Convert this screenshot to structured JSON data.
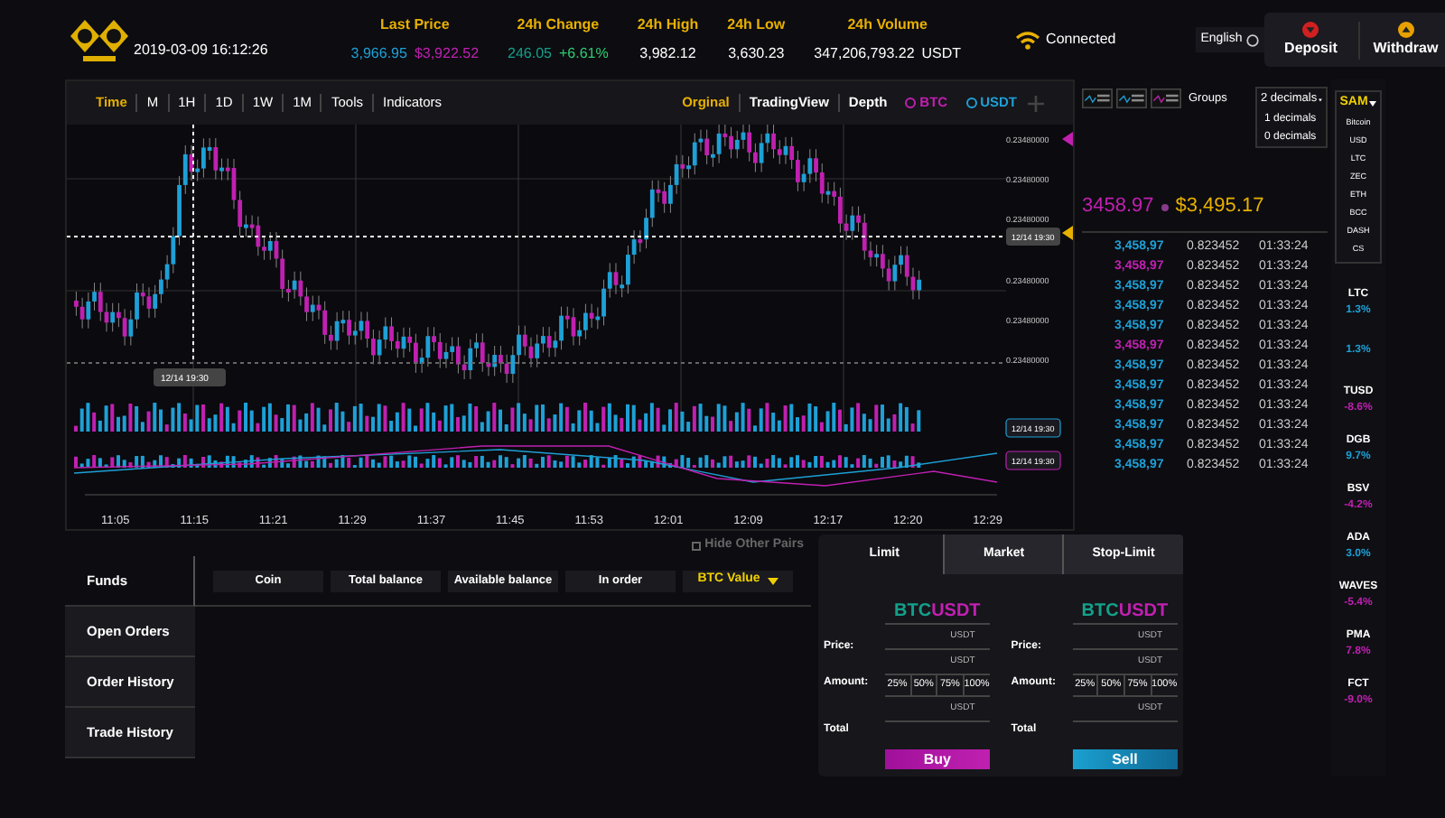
{
  "header": {
    "datetime": "2019-03-09 16:12:26",
    "stats": [
      {
        "label": "Last Price",
        "values": [
          {
            "text": "3,966.95",
            "color": "#1ea0d6"
          },
          {
            "text": "$3,922.52",
            "color": "#c020b0"
          }
        ]
      },
      {
        "label": "24h Change",
        "values": [
          {
            "text": "246.05",
            "color": "#14a08a"
          },
          {
            "text": "+6.61%",
            "color": "#2ecc71"
          }
        ]
      },
      {
        "label": "24h High",
        "values": [
          {
            "text": "3,982.12",
            "color": "#ffffff"
          }
        ]
      },
      {
        "label": "24h Low",
        "values": [
          {
            "text": "3,630.23",
            "color": "#ffffff"
          }
        ]
      },
      {
        "label": "24h Volume",
        "values": [
          {
            "text": "347,206,793.22",
            "color": "#ffffff"
          },
          {
            "text": "USDT",
            "color": "#ffffff"
          }
        ]
      }
    ],
    "connection": "Connected",
    "language": "English",
    "actions": [
      {
        "label": "Deposit",
        "kind": "down"
      },
      {
        "label": "Withdraw",
        "kind": "up"
      }
    ]
  },
  "chart": {
    "intervals": [
      {
        "label": "Time",
        "selected": true
      },
      {
        "label": "M",
        "selected": false
      },
      {
        "label": "1H",
        "selected": false
      },
      {
        "label": "1D",
        "selected": false
      },
      {
        "label": "1W",
        "selected": false
      },
      {
        "label": "1M",
        "selected": false
      },
      {
        "label": "Tools",
        "selected": false
      },
      {
        "label": "Indicators",
        "selected": false
      }
    ],
    "views": [
      {
        "label": "Orginal",
        "selected": true
      },
      {
        "label": "TradingView",
        "selected": false
      },
      {
        "label": "Depth",
        "selected": false
      }
    ],
    "legend": [
      {
        "label": "BTC",
        "color": "#c020b0"
      },
      {
        "label": "USDT",
        "color": "#1ea0d6"
      }
    ],
    "price_labels": [
      "0.23480000",
      "0.23480000",
      "0.23480000",
      "0.23480000",
      "0.23480000",
      "0.23480000"
    ],
    "crosshair_label": "12/14 19:30",
    "cursor_time": "12/14 19:30",
    "volume_label": "12/14 19:30",
    "macd_label": "12/14 19:30",
    "time_labels": [
      "11:05",
      "11:15",
      "11:21",
      "11:29",
      "11:37",
      "11:45",
      "11:53",
      "12:01",
      "12:09",
      "12:17",
      "12:20",
      "12:29"
    ]
  },
  "order_book": {
    "groups_label": "Groups",
    "decimals": "2 decimals",
    "decimal_options": [
      "1 decimals",
      "0 decimals"
    ],
    "last_price": "3458.97",
    "last_price_usd": "$3,495.17",
    "rows": [
      {
        "price": "3,458,97",
        "amount": "0.823452",
        "time": "01:33:24",
        "color": "#1ea0d6"
      },
      {
        "price": "3,458,97",
        "amount": "0.823452",
        "time": "01:33:24",
        "color": "#c020b0"
      },
      {
        "price": "3,458,97",
        "amount": "0.823452",
        "time": "01:33:24",
        "color": "#1ea0d6"
      },
      {
        "price": "3,458,97",
        "amount": "0.823452",
        "time": "01:33:24",
        "color": "#1ea0d6"
      },
      {
        "price": "3,458,97",
        "amount": "0.823452",
        "time": "01:33:24",
        "color": "#1ea0d6"
      },
      {
        "price": "3,458,97",
        "amount": "0.823452",
        "time": "01:33:24",
        "color": "#c020b0"
      },
      {
        "price": "3,458,97",
        "amount": "0.823452",
        "time": "01:33:24",
        "color": "#1ea0d6"
      },
      {
        "price": "3,458,97",
        "amount": "0.823452",
        "time": "01:33:24",
        "color": "#1ea0d6"
      },
      {
        "price": "3,458,97",
        "amount": "0.823452",
        "time": "01:33:24",
        "color": "#1ea0d6"
      },
      {
        "price": "3,458,97",
        "amount": "0.823452",
        "time": "01:33:24",
        "color": "#1ea0d6"
      },
      {
        "price": "3,458,97",
        "amount": "0.823452",
        "time": "01:33:24",
        "color": "#1ea0d6"
      },
      {
        "price": "3,458,97",
        "amount": "0.823452",
        "time": "01:33:24",
        "color": "#1ea0d6"
      }
    ]
  },
  "coins": {
    "selector": "SAM",
    "options": [
      "Bitcoin",
      "USD",
      "LTC",
      "ZEC",
      "ETH",
      "BCC",
      "DASH",
      "CS"
    ],
    "items": [
      {
        "name": "LTC",
        "change": "1.3%",
        "color": "#1ea0d6"
      },
      {
        "change": "1.3%",
        "color": "#1ea0d6"
      },
      {
        "name": "TUSD",
        "change": "-8.6%",
        "color": "#c020b0"
      },
      {
        "name": "DGB",
        "change": "9.7%",
        "color": "#1ea0d6"
      },
      {
        "name": "BSV",
        "change": "-4.2%",
        "color": "#c020b0"
      },
      {
        "name": "ADA",
        "change": "3.0%",
        "color": "#1ea0d6"
      },
      {
        "name": "WAVES",
        "change": "-5.4%",
        "color": "#c020b0"
      },
      {
        "name": "PMA",
        "change": "7.8%",
        "color": "#c020b0"
      },
      {
        "name": "FCT",
        "change": "-9.0%",
        "color": "#c020b0"
      }
    ]
  },
  "account": {
    "hide_other_pairs": {
      "label": "Hide Other Pairs",
      "checked": false
    },
    "tabs": [
      {
        "label": "Funds",
        "selected": true
      },
      {
        "label": "Open Orders",
        "selected": false
      },
      {
        "label": "Order History",
        "selected": false
      },
      {
        "label": "Trade History",
        "selected": false
      }
    ],
    "columns": [
      "Coin",
      "Total balance",
      "Available balance",
      "In order"
    ],
    "value_column": "BTC Value"
  },
  "order_form": {
    "tabs": [
      {
        "label": "Limit",
        "selected": true
      },
      {
        "label": "Market",
        "selected": false
      },
      {
        "label": "Stop-Limit",
        "selected": false
      }
    ],
    "forms": [
      {
        "base": "BTC",
        "quote": "USDT",
        "price_label": "Price:",
        "price_unit": "USDT",
        "amount_label": "Amount:",
        "amount_unit": "USDT",
        "percents": [
          "25%",
          "50%",
          "75%",
          "100%"
        ],
        "total_label": "Total",
        "total_unit": "USDT",
        "action": "Buy",
        "kind": "buy"
      },
      {
        "base": "BTC",
        "quote": "USDT",
        "price_label": "Price:",
        "price_unit": "USDT",
        "amount_label": "Amount:",
        "amount_unit": "USDT",
        "percents": [
          "25%",
          "50%",
          "75%",
          "100%"
        ],
        "total_label": "Total",
        "total_unit": "USDT",
        "action": "Sell",
        "kind": "sell"
      }
    ]
  }
}
